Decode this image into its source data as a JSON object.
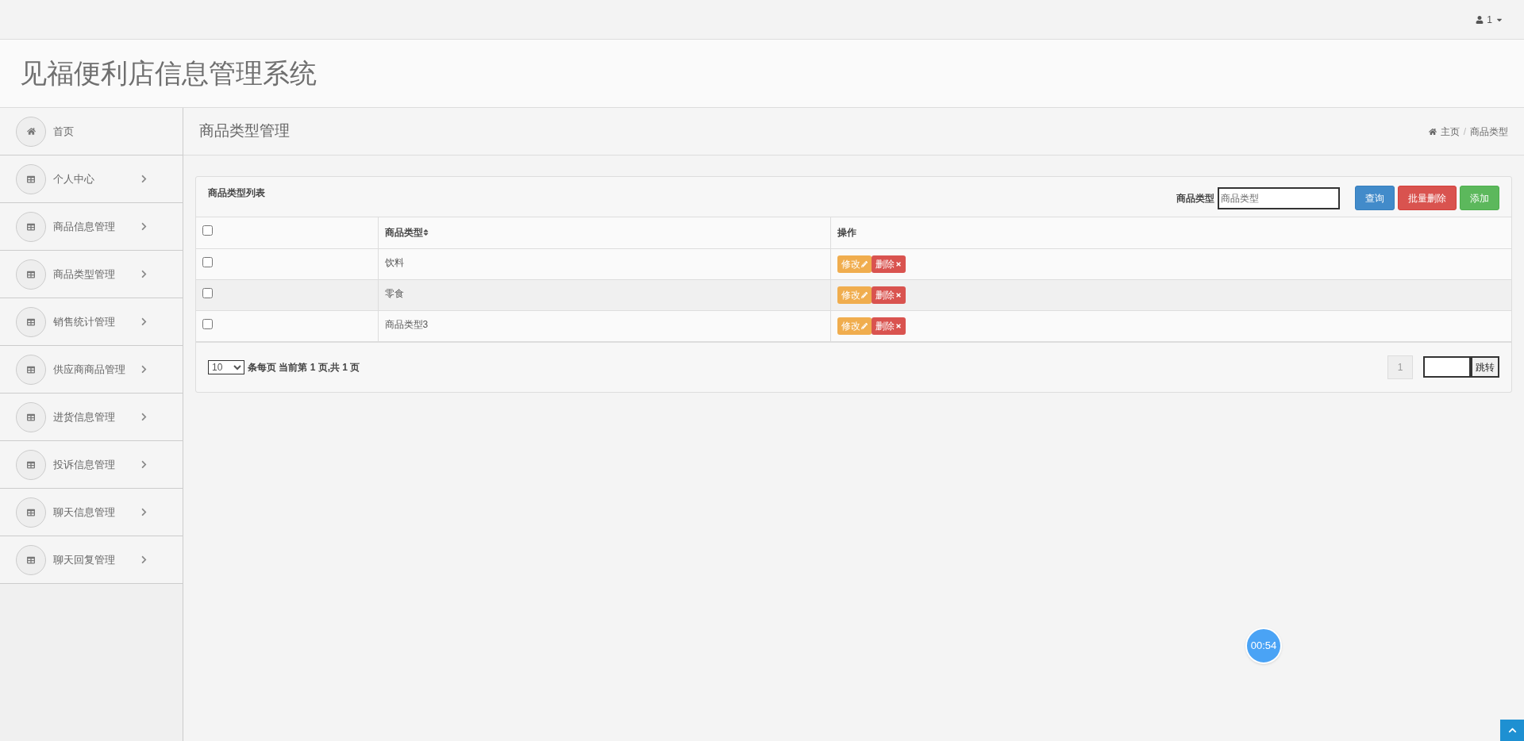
{
  "user_menu": {
    "label": "1"
  },
  "app_title": "见福便利店信息管理系统",
  "sidebar": {
    "items": [
      {
        "kind": "home",
        "label": "首页"
      },
      {
        "kind": "menu",
        "label": "个人中心"
      },
      {
        "kind": "menu",
        "label": "商品信息管理"
      },
      {
        "kind": "menu",
        "label": "商品类型管理"
      },
      {
        "kind": "menu",
        "label": "销售统计管理"
      },
      {
        "kind": "menu",
        "label": "供应商商品管理"
      },
      {
        "kind": "menu",
        "label": "进货信息管理"
      },
      {
        "kind": "menu",
        "label": "投诉信息管理"
      },
      {
        "kind": "menu",
        "label": "聊天信息管理"
      },
      {
        "kind": "menu",
        "label": "聊天回复管理"
      }
    ]
  },
  "page_title": "商品类型管理",
  "breadcrumb": [
    "主页",
    "商品类型"
  ],
  "breadcrumb_separator": "/",
  "panel": {
    "title": "商品类型列表",
    "search": {
      "label": "商品类型",
      "placeholder": "商品类型"
    },
    "buttons": [
      {
        "kind": "primary",
        "label": "查询"
      },
      {
        "kind": "danger",
        "label": "批量删除"
      },
      {
        "kind": "success",
        "label": "添加"
      }
    ],
    "table": {
      "select_all_checked": false,
      "columns": [
        "商品类型",
        "操作"
      ],
      "rows": [
        {
          "checked": false,
          "type": "饮料",
          "actions": [
            "修改",
            "删除"
          ]
        },
        {
          "checked": false,
          "type": "零食",
          "actions": [
            "修改",
            "删除"
          ]
        },
        {
          "checked": false,
          "type": "商品类型3",
          "actions": [
            "修改",
            "删除"
          ]
        }
      ]
    },
    "pager": {
      "page_size": "10",
      "summary": "条每页 当前第 1 页,共 1 页",
      "pages": [
        {
          "label": "1",
          "selected": true
        }
      ],
      "jump_label": "跳转"
    }
  },
  "timer": "00:54"
}
